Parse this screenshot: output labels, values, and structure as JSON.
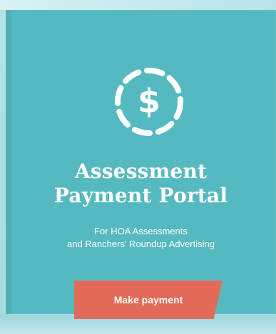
{
  "colors": {
    "card_bg": "#55babf",
    "button_bg": "#e36a59",
    "text": "#ffffff"
  },
  "hero": {
    "icon": "dollar-circle-icon",
    "title_line1": "Assessment",
    "title_line2": "Payment Portal",
    "subtitle_line1": "For HOA Assessments",
    "subtitle_line2": "and Ranchers’ Roundup Advertising",
    "button_label": "Make payment"
  }
}
